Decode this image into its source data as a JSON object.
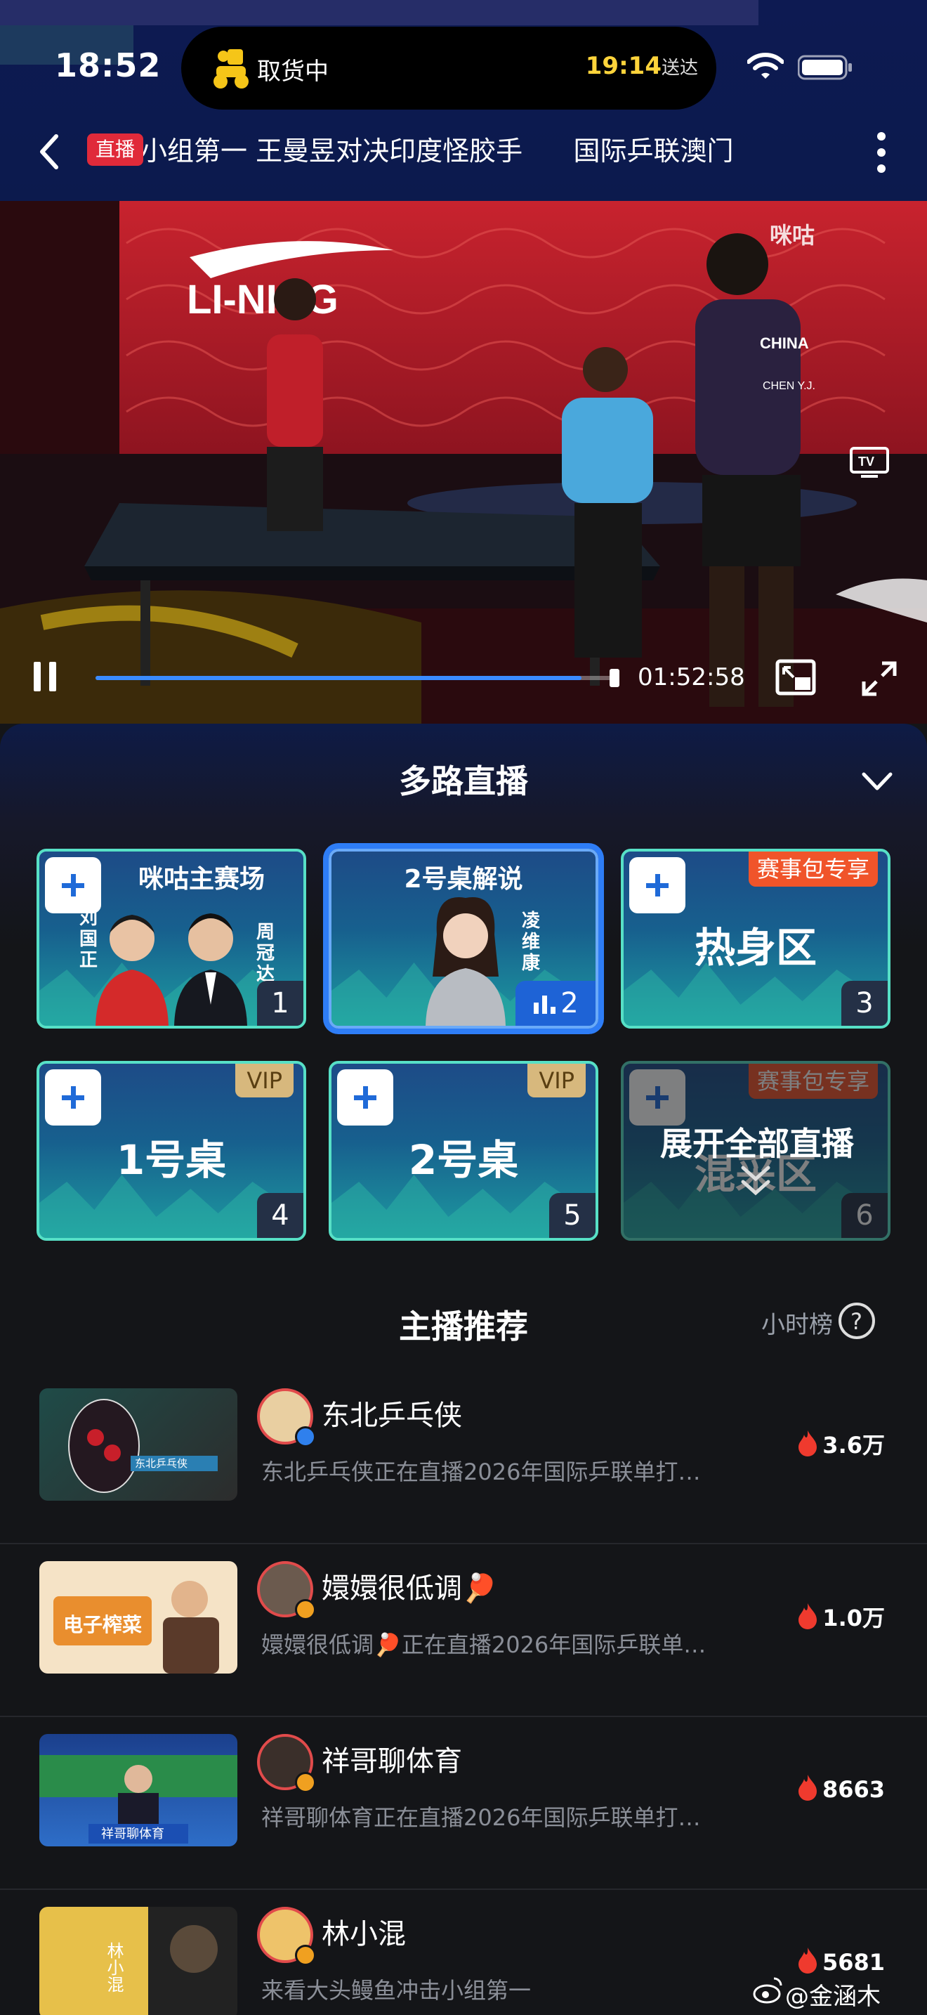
{
  "status_bar": {
    "time": "18:52",
    "island_label": "取货中",
    "eta_time": "19:14",
    "eta_suffix": "送达"
  },
  "header": {
    "live_badge": "直播",
    "title_text": "锁定小组第一 王曼昱对决印度怪胶手      国际乒联澳门"
  },
  "video": {
    "time": "01:52:58",
    "progress": 0.93,
    "brand": "LI-NING",
    "watermark": "咪咕",
    "jersey_text": "CHINA",
    "jersey_name": "CHEN Y.J."
  },
  "multi_live": {
    "title": "多路直播",
    "cards": [
      {
        "label": "咪咕主赛场",
        "number": "1",
        "host_a": "刘国正",
        "host_b": "周冠达"
      },
      {
        "label": "2号桌解说",
        "number": "2",
        "host": "凌维康"
      },
      {
        "label": "热身区",
        "number": "3",
        "badge": "赛事包专享"
      },
      {
        "label": "1号桌",
        "number": "4",
        "badge": "VIP"
      },
      {
        "label": "2号桌",
        "number": "5",
        "badge": "VIP"
      },
      {
        "label": "混采区",
        "number": "6",
        "badge": "赛事包专享"
      }
    ],
    "expand_label": "展开全部直播"
  },
  "recommend": {
    "title": "主播推荐",
    "hourly_label": "小时榜",
    "items": [
      {
        "name": "东北乒乓侠",
        "desc": "东北乒乓侠正在直播2026年国际乒联单打…",
        "heat": "3.6万",
        "thumb_text": "东北乒乓侠"
      },
      {
        "name": "嬛嬛很低调🏓",
        "desc": "嬛嬛很低调🏓正在直播2026年国际乒联单…",
        "heat": "1.0万",
        "thumb_text": "电子榨菜"
      },
      {
        "name": "祥哥聊体育",
        "desc": "祥哥聊体育正在直播2026年国际乒联单打…",
        "heat": "8663",
        "thumb_text": "祥哥聊体育"
      },
      {
        "name": "林小混",
        "desc": "来看大头鳗鱼冲击小组第一",
        "heat": "5681",
        "thumb_text": "林小混"
      }
    ]
  },
  "watermark": "@金涵木",
  "colors": {
    "accent": "#2e7df6",
    "live_red": "#e02a3a",
    "card_border": "#57e0c6",
    "vip_gold": "#d7b87d",
    "exclusive_orange": "#f0542a"
  }
}
